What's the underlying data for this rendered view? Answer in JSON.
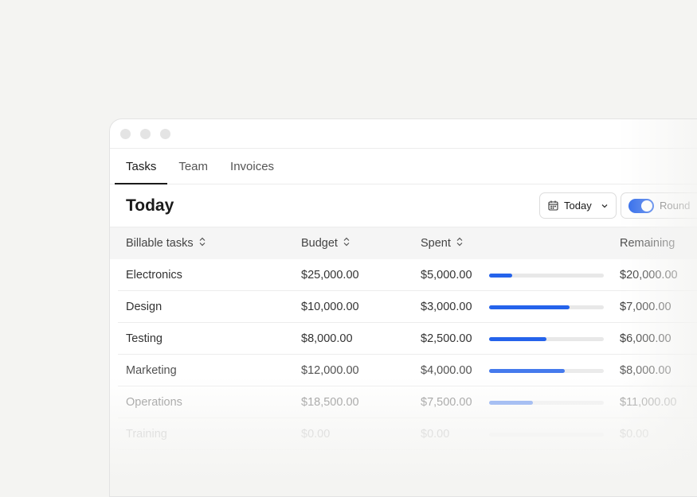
{
  "tabs": [
    {
      "label": "Tasks",
      "active": true
    },
    {
      "label": "Team",
      "active": false
    },
    {
      "label": "Invoices",
      "active": false
    }
  ],
  "header": {
    "title": "Today",
    "date_button": "Today",
    "round_toggle": "Round",
    "round_toggle_on": true
  },
  "table": {
    "columns": [
      "Billable tasks",
      "Budget",
      "Spent",
      "Remaining"
    ],
    "rows": [
      {
        "task": "Electronics",
        "budget": "$25,000.00",
        "spent": "$5,000.00",
        "progress": 0.2,
        "remaining": "$20,000.00"
      },
      {
        "task": "Design",
        "budget": "$10,000.00",
        "spent": "$3,000.00",
        "progress": 0.7,
        "remaining": "$7,000.00"
      },
      {
        "task": "Testing",
        "budget": "$8,000.00",
        "spent": "$2,500.00",
        "progress": 0.5,
        "remaining": "$6,000.00"
      },
      {
        "task": "Marketing",
        "budget": "$12,000.00",
        "spent": "$4,000.00",
        "progress": 0.66,
        "remaining": "$8,000.00"
      },
      {
        "task": "Operations",
        "budget": "$18,500.00",
        "spent": "$7,500.00",
        "progress": 0.38,
        "remaining": "$11,000.00"
      },
      {
        "task": "Training",
        "budget": "$0.00",
        "spent": "$0.00",
        "progress": 0,
        "remaining": "$0.00"
      }
    ]
  },
  "colors": {
    "accent": "#2563eb",
    "track": "#e8e8e8",
    "background": "#f4f4f2"
  }
}
